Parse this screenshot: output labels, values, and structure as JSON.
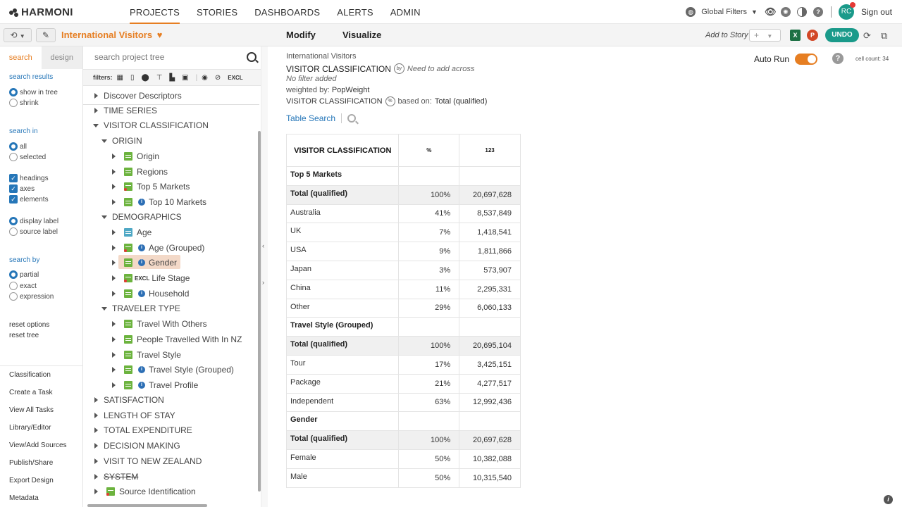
{
  "app": {
    "logo": "HARMONI"
  },
  "nav": {
    "items": [
      "PROJECTS",
      "STORIES",
      "DASHBOARDS",
      "ALERTS",
      "ADMIN"
    ],
    "active": "PROJECTS"
  },
  "topright": {
    "global_filters": "Global Filters",
    "avatar": "RC",
    "signout": "Sign out"
  },
  "project": {
    "name": "International Visitors"
  },
  "left": {
    "tabs": [
      "search",
      "design"
    ],
    "search_results_title": "search results",
    "show_in_tree": "show in tree",
    "shrink": "shrink",
    "search_in_title": "search in",
    "all": "all",
    "selected": "selected",
    "headings": "headings",
    "axes": "axes",
    "elements": "elements",
    "display_label": "display label",
    "source_label": "source label",
    "search_by_title": "search by",
    "partial": "partial",
    "exact": "exact",
    "expression": "expression",
    "reset_options": "reset options",
    "reset_tree": "reset tree",
    "links": [
      "Classification",
      "Create a Task",
      "View All Tasks",
      "Library/Editor",
      "View/Add Sources",
      "Publish/Share",
      "Export Design",
      "Metadata"
    ]
  },
  "tree": {
    "search_placeholder": "search project tree",
    "filters_label": "filters:",
    "excl_label": "EXCL",
    "discover": "Discover Descriptors",
    "items": {
      "time_series": "TIME SERIES",
      "visitor_classification": "VISITOR CLASSIFICATION",
      "origin_group": "ORIGIN",
      "origin": "Origin",
      "regions": "Regions",
      "top5": "Top 5 Markets",
      "top10": "Top 10 Markets",
      "demographics": "DEMOGRAPHICS",
      "age": "Age",
      "age_grouped": "Age (Grouped)",
      "gender": "Gender",
      "life_stage": "Life Stage",
      "household": "Household",
      "traveler_type": "TRAVELER TYPE",
      "travel_with_others": "Travel With Others",
      "people_travelled": "People Travelled With In NZ",
      "travel_style": "Travel Style",
      "travel_style_grouped": "Travel Style (Grouped)",
      "travel_profile": "Travel Profile",
      "satisfaction": "SATISFACTION",
      "length_of_stay": "LENGTH OF STAY",
      "total_expenditure": "TOTAL EXPENDITURE",
      "decision_making": "DECISION MAKING",
      "visit_nz": "VISIT TO NEW ZEALAND",
      "system": "SYSTEM",
      "source_id": "Source Identification"
    }
  },
  "toolbar": {
    "modify": "Modify",
    "visualize": "Visualize",
    "add_to_story": "Add to Story",
    "xlsx": "X",
    "pptx": "P",
    "undo": "UNDO"
  },
  "main": {
    "crumb": "International Visitors",
    "title": "VISITOR CLASSIFICATION",
    "by_icon": "by",
    "need_add": "Need to add across",
    "no_filter": "No filter added",
    "weighted_prefix": "weighted by:",
    "weight": "PopWeight",
    "basedon_title": "VISITOR CLASSIFICATION",
    "pct_icon": "%",
    "basedon_prefix": "based on:",
    "basedon_value": "Total (qualified)",
    "table_search": "Table Search",
    "auto_run": "Auto Run",
    "help_icon": "?",
    "cell_count": "cell count: 34"
  },
  "table": {
    "headers": [
      "VISITOR CLASSIFICATION",
      "%",
      "123"
    ],
    "rows": [
      {
        "type": "section",
        "label": "Top 5 Markets",
        "pct": "",
        "num": ""
      },
      {
        "type": "total",
        "label": "Total (qualified)",
        "pct": "100%",
        "num": "20,697,628"
      },
      {
        "type": "row",
        "label": "Australia",
        "pct": "41%",
        "num": "8,537,849"
      },
      {
        "type": "row",
        "label": "UK",
        "pct": "7%",
        "num": "1,418,541"
      },
      {
        "type": "row",
        "label": "USA",
        "pct": "9%",
        "num": "1,811,866"
      },
      {
        "type": "row",
        "label": "Japan",
        "pct": "3%",
        "num": "573,907"
      },
      {
        "type": "row",
        "label": "China",
        "pct": "11%",
        "num": "2,295,331"
      },
      {
        "type": "row",
        "label": "Other",
        "pct": "29%",
        "num": "6,060,133"
      },
      {
        "type": "section",
        "label": "Travel Style (Grouped)",
        "pct": "",
        "num": ""
      },
      {
        "type": "total",
        "label": "Total (qualified)",
        "pct": "100%",
        "num": "20,695,104"
      },
      {
        "type": "row",
        "label": "Tour",
        "pct": "17%",
        "num": "3,425,151"
      },
      {
        "type": "row",
        "label": "Package",
        "pct": "21%",
        "num": "4,277,517"
      },
      {
        "type": "row",
        "label": "Independent",
        "pct": "63%",
        "num": "12,992,436"
      },
      {
        "type": "section",
        "label": "Gender",
        "pct": "",
        "num": ""
      },
      {
        "type": "total",
        "label": "Total (qualified)",
        "pct": "100%",
        "num": "20,697,628"
      },
      {
        "type": "row",
        "label": "Female",
        "pct": "50%",
        "num": "10,382,088"
      },
      {
        "type": "row",
        "label": "Male",
        "pct": "50%",
        "num": "10,315,540"
      }
    ]
  },
  "colors": {
    "accent": "#e67e22",
    "teal": "#1a9a8a",
    "link": "#2576b8",
    "var_green": "#6cb33e"
  }
}
